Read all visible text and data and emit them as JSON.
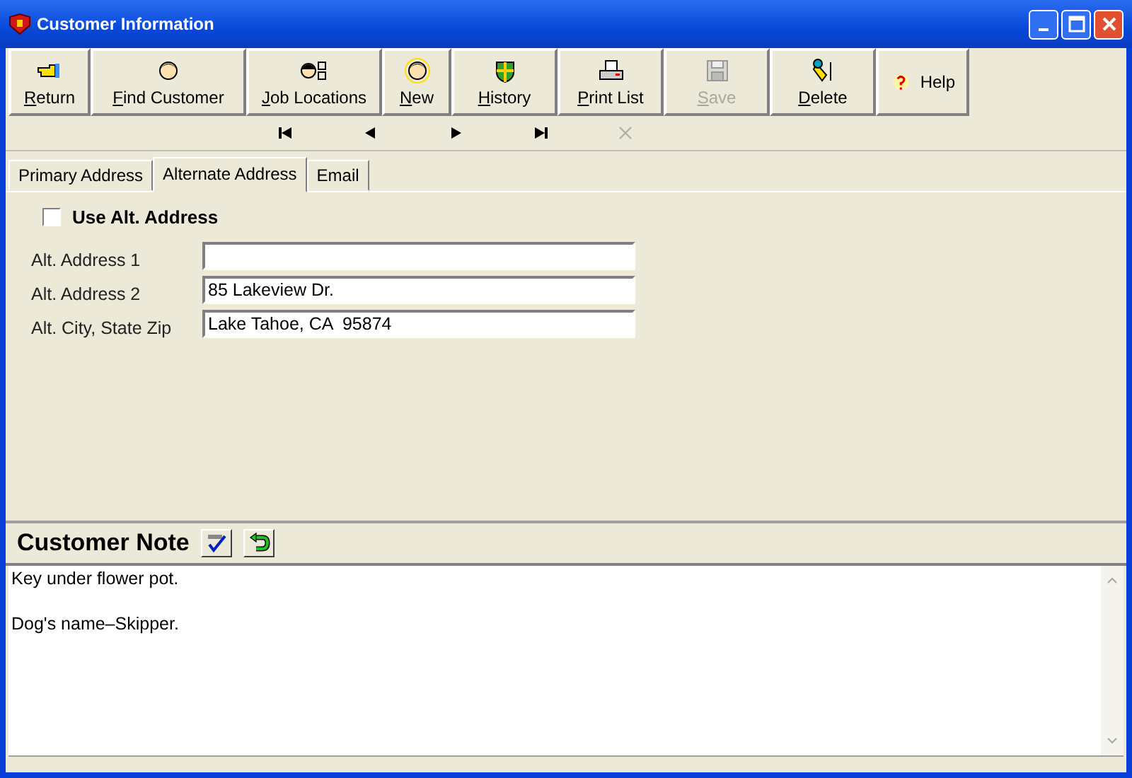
{
  "window": {
    "title": "Customer Information"
  },
  "toolbar": [
    {
      "label": "Return",
      "kind": "return",
      "mnemonic": true,
      "disabled": false
    },
    {
      "label": "Find Customer",
      "kind": "person",
      "mnemonic": true,
      "disabled": false
    },
    {
      "label": "Job Locations",
      "kind": "locations",
      "mnemonic": true,
      "disabled": false
    },
    {
      "label": "New",
      "kind": "new",
      "mnemonic": true,
      "disabled": false
    },
    {
      "label": "History",
      "kind": "history",
      "mnemonic": true,
      "disabled": false
    },
    {
      "label": "Print List",
      "kind": "print",
      "mnemonic": true,
      "disabled": false
    },
    {
      "label": "Save",
      "kind": "save",
      "mnemonic": true,
      "disabled": true
    },
    {
      "label": "Delete",
      "kind": "delete",
      "mnemonic": true,
      "disabled": false
    },
    {
      "label": "Help",
      "kind": "help",
      "mnemonic": false,
      "disabled": false
    }
  ],
  "navigation": [
    {
      "kind": "first",
      "disabled": false
    },
    {
      "kind": "previous",
      "disabled": false
    },
    {
      "kind": "next",
      "disabled": false
    },
    {
      "kind": "last",
      "disabled": false
    },
    {
      "kind": "cancel",
      "disabled": true
    }
  ],
  "tabs": [
    {
      "label": "Primary Address",
      "selected": false
    },
    {
      "label": "Alternate Address",
      "selected": true
    },
    {
      "label": "Email",
      "selected": false
    }
  ],
  "use_alt_address": {
    "label": "Use Alt. Address",
    "checked": false
  },
  "fields": [
    {
      "label": "Alt. Address 1"
    },
    {
      "label": "Alt. Address 2",
      "value": "85 Lakeview Dr."
    },
    {
      "label": "Alt. City, State Zip",
      "value": "Lake Tahoe, CA  95874"
    }
  ],
  "note": {
    "title": "Customer Note",
    "lines": [
      "Key under flower pot.",
      "Dog's name–Skipper."
    ]
  }
}
